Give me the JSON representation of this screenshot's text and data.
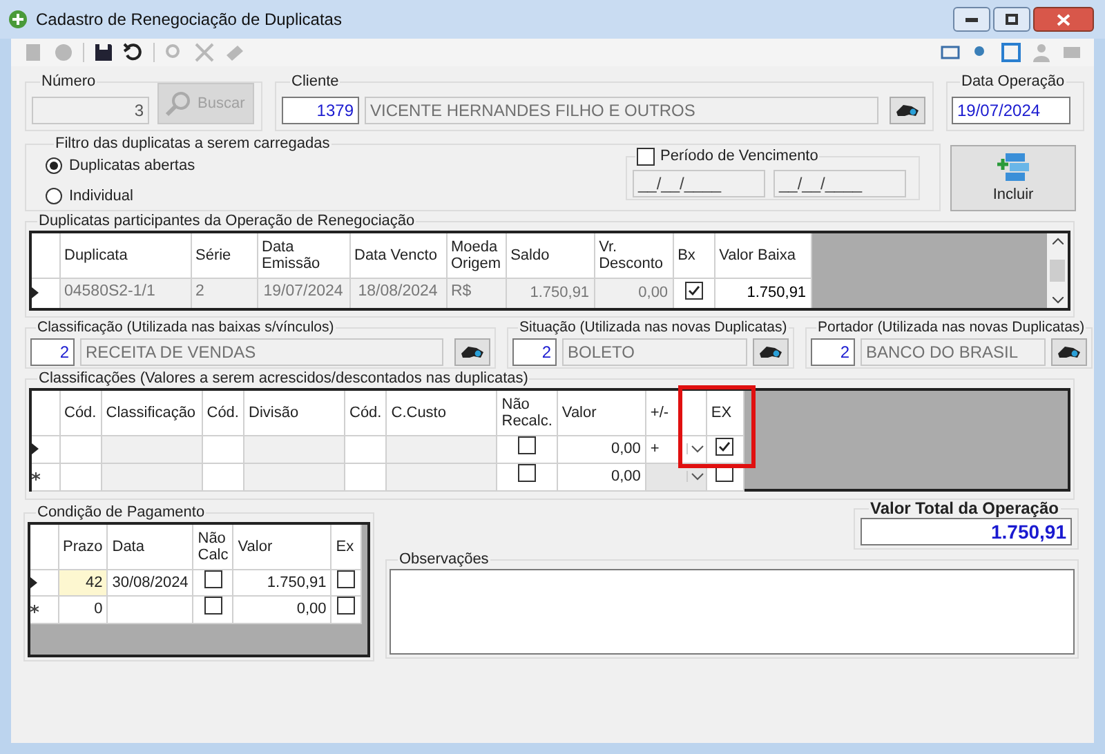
{
  "window": {
    "title": "Cadastro de Renegociação de Duplicatas"
  },
  "toolbar": {
    "left": [
      {
        "disabled": true
      },
      {
        "disabled": true
      },
      {
        "disabled": false
      },
      {
        "disabled": false
      },
      {
        "disabled": true
      },
      {
        "disabled": true
      },
      {
        "disabled": true
      }
    ],
    "right": [
      {
        "disabled": false
      },
      {
        "disabled": false
      },
      {
        "disabled": false
      },
      {
        "disabled": true
      },
      {
        "disabled": true
      }
    ]
  },
  "numero": {
    "label": "Número",
    "value": "3",
    "search_button": {
      "label": "Buscar",
      "disabled": true
    }
  },
  "cliente": {
    "label": "Cliente",
    "code": "1379",
    "name": "VICENTE HERNANDES FILHO E OUTROS"
  },
  "data_operacao": {
    "label": "Data Operação",
    "value": "19/07/2024"
  },
  "filtro": {
    "label": "Filtro das duplicatas a serem carregadas",
    "options": [
      {
        "label": "Duplicatas abertas",
        "selected": true
      },
      {
        "label": "Individual",
        "selected": false
      }
    ],
    "periodo": {
      "label": "Período de Vencimento",
      "checked": false,
      "start": "__/__/____",
      "end": "__/__/____"
    }
  },
  "include_button": {
    "label": "Incluir"
  },
  "duplicatas": {
    "label": "Duplicatas participantes da Operação de Renegociação",
    "columns": [
      "Duplicata",
      "Série",
      "Data Emissão",
      "Data Vencto",
      "Moeda Origem",
      "Saldo",
      "Vr. Desconto",
      "Bx",
      "Valor Baixa"
    ],
    "rows": [
      {
        "kind": "current",
        "duplicata": "04580S2-1/1",
        "serie": "2",
        "emissao": "19/07/2024",
        "vencto": "18/08/2024",
        "moeda": "R$",
        "saldo": "1.750,91",
        "desconto": "0,00",
        "bx": true,
        "valor_baixa": "1.750,91"
      }
    ]
  },
  "lookups": [
    {
      "label": "Classificação (Utilizada nas baixas s/vínculos)",
      "code": "2",
      "name": "RECEITA DE VENDAS"
    },
    {
      "label": "Situação (Utilizada nas novas Duplicatas)",
      "code": "2",
      "name": "BOLETO"
    },
    {
      "label": "Portador (Utilizada nas novas Duplicatas)",
      "code": "2",
      "name": "BANCO DO BRASIL"
    }
  ],
  "classificacoes": {
    "label": "Classificações (Valores a serem acrescidos/descontados nas duplicatas)",
    "columns": [
      "Cód.",
      "Classificação",
      "Cód.",
      "Divisão",
      "Cód.",
      "C.Custo",
      "Não Recalc.",
      "Valor",
      "+/-",
      "EX"
    ],
    "rows": [
      {
        "kind": "current",
        "nao_recalc": false,
        "valor": "0,00",
        "sign": "+",
        "ex": true
      },
      {
        "kind": "new",
        "nao_recalc": false,
        "valor": "0,00",
        "ex": false
      }
    ]
  },
  "condicao": {
    "label": "Condição de Pagamento",
    "columns": [
      "Prazo",
      "Data",
      "Não Calc",
      "Valor",
      "Ex"
    ],
    "rows": [
      {
        "kind": "current",
        "prazo": "42",
        "data": "30/08/2024",
        "nao_calc": false,
        "valor": "1.750,91",
        "ex": false
      },
      {
        "kind": "new",
        "prazo": "0",
        "nao_calc": false,
        "valor": "0,00",
        "ex": false
      }
    ]
  },
  "valor_total": {
    "label": "Valor Total da Operação",
    "value": "1.750,91"
  },
  "observacoes": {
    "label": "Observações"
  }
}
